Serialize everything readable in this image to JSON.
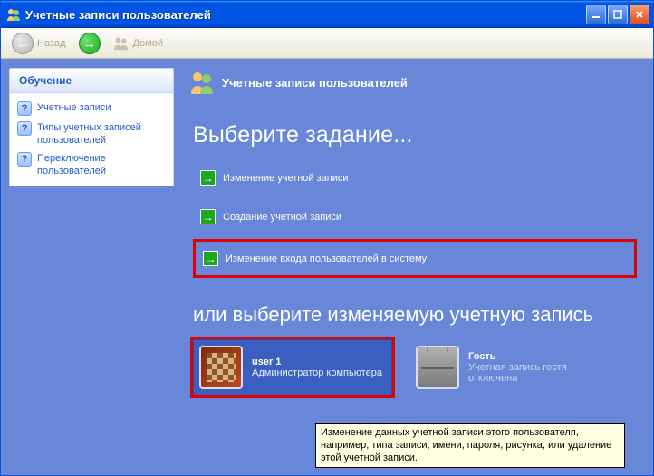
{
  "window": {
    "title": "Учетные записи пользователей"
  },
  "toolbar": {
    "back": "Назад",
    "home": "Домой"
  },
  "sidebar": {
    "header": "Обучение",
    "items": [
      {
        "label": "Учетные записи"
      },
      {
        "label": "Типы учетных записей пользователей"
      },
      {
        "label": "Переключение пользователей"
      }
    ]
  },
  "page": {
    "header": "Учетные записи пользователей",
    "heading1": "Выберите задание...",
    "heading2": "или выберите изменяемую учетную запись",
    "tasks": [
      {
        "label": "Изменение учетной записи"
      },
      {
        "label": "Создание учетной записи"
      },
      {
        "label": "Изменение входа пользователей в систему"
      }
    ],
    "accounts": [
      {
        "name": "user 1",
        "role": "Администратор компьютера"
      },
      {
        "name": "Гость",
        "role": "Учетная запись гостя отключена"
      }
    ],
    "tooltip": "Изменение данных учетной записи этого пользователя, например, типа записи, имени, пароля, рисунка, или удаление этой учетной записи."
  }
}
